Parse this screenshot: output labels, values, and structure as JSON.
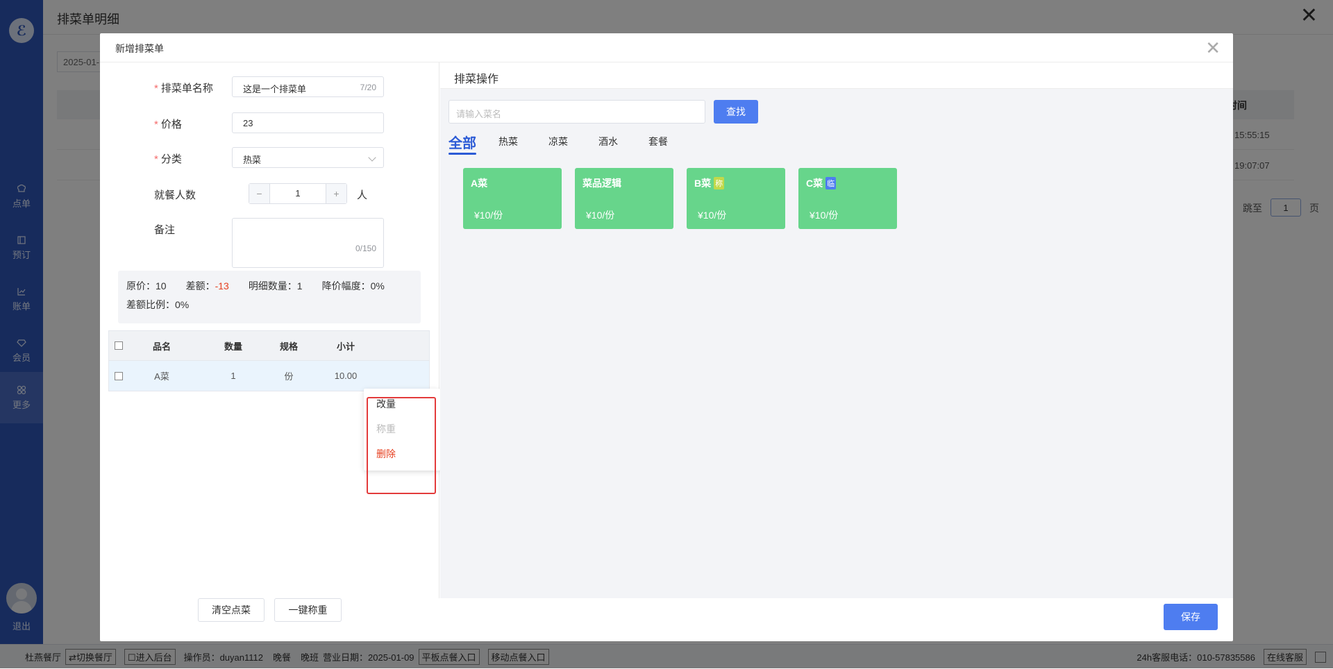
{
  "sidebar": {
    "logo": "ℰ",
    "items": [
      {
        "label": "点单",
        "icon": "chef-hat-icon"
      },
      {
        "label": "预订",
        "icon": "book-icon"
      },
      {
        "label": "账单",
        "icon": "chart-icon"
      },
      {
        "label": "会员",
        "icon": "diamond-icon"
      },
      {
        "label": "更多",
        "icon": "grid-icon"
      }
    ],
    "logout": "退出"
  },
  "background_page": {
    "title": "排菜单明细",
    "date_filter": "2025-01-",
    "time_column": "时间",
    "row_times": [
      "15:55:15",
      "19:07:07"
    ],
    "jump_label": "跳至",
    "jump_value": "1",
    "page_suffix": "页"
  },
  "modal": {
    "title": "新增排菜单",
    "form": {
      "name_label": "排菜单名称",
      "name_value": "这是一个排菜单",
      "name_count": "7/20",
      "price_label": "价格",
      "price_value": "23",
      "category_label": "分类",
      "category_value": "热菜",
      "diners_label": "就餐人数",
      "diners_value": "1",
      "diners_unit": "人",
      "remark_label": "备注",
      "remark_count": "0/150"
    },
    "summary": {
      "original_price": "原价：10",
      "diff_label": "差额：",
      "diff_value": "-13",
      "detail_count": "明细数量：1",
      "discount": "降价幅度：0%",
      "diff_ratio": "差额比例：0%"
    },
    "table": {
      "headers": [
        "品名",
        "数量",
        "规格",
        "小计"
      ],
      "rows": [
        {
          "name": "A菜",
          "qty": "1",
          "spec": "份",
          "subtotal": "10.00"
        }
      ]
    },
    "context_menu": [
      "改量",
      "称重",
      "删除"
    ],
    "clear_button": "清空点菜",
    "weigh_all_button": "一键称重",
    "save_button": "保存",
    "colors": {
      "primary": "#4e7df0",
      "dish_card": "#67d58b",
      "danger": "#e63f1f",
      "highlight": "#e33b3b"
    }
  },
  "dish_panel": {
    "title": "排菜操作",
    "search_placeholder": "请输入菜名",
    "search_button": "查找",
    "categories": [
      "全部",
      "热菜",
      "凉菜",
      "酒水",
      "套餐"
    ],
    "dishes": [
      {
        "name": "A菜",
        "tag": "",
        "price": "¥10/份"
      },
      {
        "name": "菜品逻辑",
        "tag": "",
        "price": "¥10/份"
      },
      {
        "name": "B菜",
        "tag": "称",
        "price": "¥10/份"
      },
      {
        "name": "C菜",
        "tag": "临",
        "price": "¥10/份"
      }
    ]
  },
  "statusbar": {
    "restaurant": "杜燕餐厅",
    "switch": "⇄切换餐厅",
    "backend": "☐进入后台",
    "operator": "操作员：duyan1112",
    "meal": "晚餐",
    "shift": "晚班",
    "business_date": "营业日期：2025-01-09",
    "tablet_entry": "平板点餐入口",
    "mobile_entry": "移动点餐入口",
    "hotline": "24h客服电话：010-57835586",
    "online_service": "在线客服"
  }
}
